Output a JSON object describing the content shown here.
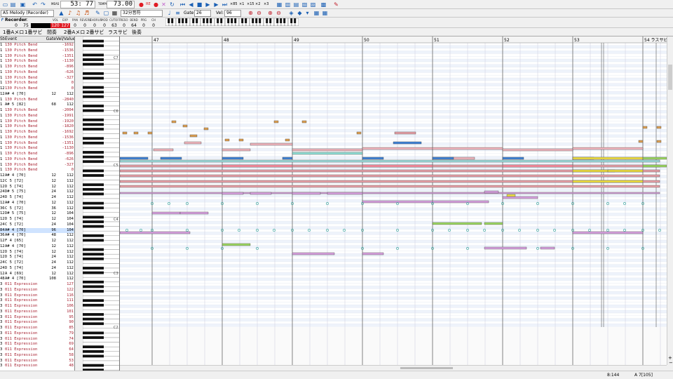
{
  "toolbar": {
    "measure_label": "MEAS",
    "position": "53: 77",
    "tempo_label": "TEMPO",
    "tempo": "73.00",
    "zoom_labels": [
      "×85",
      "×1",
      "×15",
      "×2",
      "×3"
    ],
    "track_select": "A5 Melody (Recorder)",
    "note_length_select": "32分音符",
    "gate_label": "Gate:",
    "gate_value": "26",
    "vel_label": "Vel:",
    "vel_value": "96",
    "colors": {
      "rec_red": "#e01b24",
      "play_blue": "#1a5fb4"
    }
  },
  "track": {
    "name": "Recorder",
    "params": [
      {
        "h": "M",
        "v": "0"
      },
      {
        "h": "PC",
        "v": "75"
      },
      {
        "h": "",
        "v": ""
      },
      {
        "h": "",
        "v": ""
      },
      {
        "h": "VOL",
        "v": "120"
      },
      {
        "h": "EXP",
        "v": "127"
      },
      {
        "h": "PAN",
        "v": "0"
      },
      {
        "h": "REVERB",
        "v": "0"
      },
      {
        "h": "CHORUS",
        "v": "0"
      },
      {
        "h": "MOD",
        "v": "0"
      },
      {
        "h": "CUTOFF",
        "v": "63"
      },
      {
        "h": "RESO",
        "v": "0"
      },
      {
        "h": "BEND",
        "v": "64"
      },
      {
        "h": "PRG",
        "v": "0"
      },
      {
        "h": "CH",
        "v": "0"
      }
    ]
  },
  "tabs": [
    "1番Aメロ",
    "1番サビ",
    "間奏",
    "2番Aメロ",
    "2番サビ",
    "ラスサビ",
    "後奏"
  ],
  "event_list": {
    "headers": [
      "Step",
      "Event",
      "Gate",
      "Vel/Value"
    ],
    "rows": [
      [
        "1",
        "130 Pitch Bend",
        "",
        "-1692"
      ],
      [
        "1",
        "130 Pitch Bend",
        "",
        "-1536"
      ],
      [
        "1",
        "130 Pitch Bend",
        "",
        "-1351"
      ],
      [
        "1",
        "130 Pitch Bend",
        "",
        "-1130"
      ],
      [
        "1",
        "130 Pitch Bend",
        "",
        "-896"
      ],
      [
        "1",
        "130 Pitch Bend",
        "",
        "-626"
      ],
      [
        "1",
        "130 Pitch Bend",
        "",
        "-327"
      ],
      [
        "1",
        "130 Pitch Bend",
        "",
        "0"
      ],
      [
        "12",
        "130 Pitch Bend",
        "",
        "0"
      ],
      [
        "12",
        "A# 4 [70]",
        "12",
        "112"
      ],
      [
        "1",
        "130 Pitch Bend",
        "",
        "-2840"
      ],
      [
        "1",
        "A# 5 [82]",
        "68",
        "112"
      ],
      [
        "1",
        "130 Pitch Bend",
        "",
        "-2004"
      ],
      [
        "1",
        "130 Pitch Bend",
        "",
        "-1991"
      ],
      [
        "1",
        "130 Pitch Bend",
        "",
        "-1920"
      ],
      [
        "1",
        "130 Pitch Bend",
        "",
        "-1820"
      ],
      [
        "1",
        "130 Pitch Bend",
        "",
        "-1692"
      ],
      [
        "1",
        "130 Pitch Bend",
        "",
        "-1536"
      ],
      [
        "1",
        "130 Pitch Bend",
        "",
        "-1351"
      ],
      [
        "1",
        "130 Pitch Bend",
        "",
        "-1130"
      ],
      [
        "1",
        "130 Pitch Bend",
        "",
        "-896"
      ],
      [
        "1",
        "130 Pitch Bend",
        "",
        "-626"
      ],
      [
        "1",
        "130 Pitch Bend",
        "",
        "-327"
      ],
      [
        "1",
        "130 Pitch Bend",
        "",
        "0"
      ],
      [
        "12",
        "A# 4 [70]",
        "12",
        "112"
      ],
      [
        "12",
        "C 5 [72]",
        "12",
        "112"
      ],
      [
        "12",
        "D 5 [74]",
        "12",
        "112"
      ],
      [
        "24",
        "D# 5 [75]",
        "24",
        "112"
      ],
      [
        "24",
        "D 5 [74]",
        "24",
        "112"
      ],
      [
        "12",
        "A# 4 [70]",
        "12",
        "112"
      ],
      [
        "36",
        "C 5 [72]",
        "36",
        "112"
      ],
      [
        "12",
        "D# 5 [75]",
        "12",
        "104"
      ],
      [
        "12",
        "D 5 [74]",
        "12",
        "104"
      ],
      [
        "24",
        "C 5 [72]",
        "24",
        "104"
      ],
      [
        "84",
        "A# 4 [70]",
        "96",
        "104"
      ],
      [
        "36",
        "A# 4 [70]",
        "48",
        "112"
      ],
      [
        "12",
        "F 4 [65]",
        "12",
        "112"
      ],
      [
        "12",
        "A# 4 [70]",
        "12",
        "112"
      ],
      [
        "12",
        "D 5 [74]",
        "12",
        "112"
      ],
      [
        "12",
        "D 5 [74]",
        "24",
        "112"
      ],
      [
        "24",
        "C 5 [72]",
        "24",
        "112"
      ],
      [
        "24",
        "D 5 [74]",
        "24",
        "112"
      ],
      [
        "12",
        "A 4 [69]",
        "12",
        "112"
      ],
      [
        "48",
        "A# 4 [70]",
        "108",
        "112"
      ],
      [
        "3",
        "011 Expression",
        "",
        "127"
      ],
      [
        "3",
        "011 Expression",
        "",
        "122"
      ],
      [
        "3",
        "011 Expression",
        "",
        "116"
      ],
      [
        "3",
        "011 Expression",
        "",
        "111"
      ],
      [
        "3",
        "011 Expression",
        "",
        "106"
      ],
      [
        "3",
        "011 Expression",
        "",
        "101"
      ],
      [
        "3",
        "011 Expression",
        "",
        "95"
      ],
      [
        "3",
        "011 Expression",
        "",
        "90"
      ],
      [
        "3",
        "011 Expression",
        "",
        "85"
      ],
      [
        "3",
        "011 Expression",
        "",
        "79"
      ],
      [
        "3",
        "011 Expression",
        "",
        "74"
      ],
      [
        "3",
        "011 Expression",
        "",
        "69"
      ],
      [
        "3",
        "011 Expression",
        "",
        "64"
      ],
      [
        "3",
        "011 Expression",
        "",
        "58"
      ],
      [
        "3",
        "011 Expression",
        "",
        "53"
      ],
      [
        "3",
        "011 Expression",
        "",
        "48"
      ]
    ]
  },
  "piano_roll": {
    "measures": [
      "47",
      "48",
      "49",
      "50",
      "51",
      "52",
      "53",
      "54 ラスサビ"
    ],
    "octave_labels": [
      "C6",
      "C5",
      "C4",
      "C3",
      "C2"
    ]
  },
  "status": {
    "left": "8:144",
    "right": "A 7[105]"
  }
}
